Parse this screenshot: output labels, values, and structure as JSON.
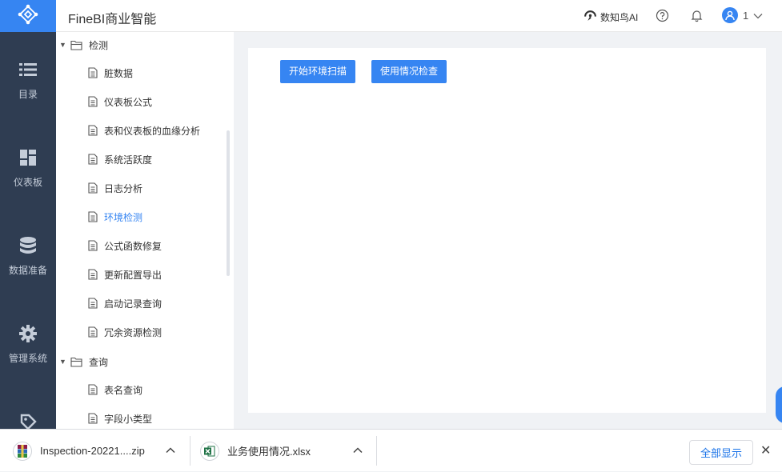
{
  "header": {
    "logo_icon": "network-nodes-icon",
    "title": "FineBI商业智能",
    "ai_label": "数知鸟AI",
    "user_name": "1"
  },
  "leftnav": {
    "items": [
      {
        "label": "目录",
        "icon": "list-icon"
      },
      {
        "label": "仪表板",
        "icon": "dashboard-icon"
      },
      {
        "label": "数据准备",
        "icon": "database-icon"
      },
      {
        "label": "管理系统",
        "icon": "gear-icon"
      },
      {
        "label": "",
        "icon": "tag-icon"
      }
    ]
  },
  "tree": {
    "folders": [
      {
        "label": "检测",
        "children": [
          "脏数据",
          "仪表板公式",
          "表和仪表板的血缘分析",
          "系统活跃度",
          "日志分析",
          "环境检测",
          "公式函数修复",
          "更新配置导出",
          "启动记录查询",
          "冗余资源检测"
        ]
      },
      {
        "label": "查询",
        "children": [
          "表名查询",
          "字段小类型"
        ]
      }
    ],
    "active": "环境检测"
  },
  "main": {
    "scan_button": "开始环境扫描",
    "usage_button": "使用情况检查"
  },
  "downloads": {
    "items": [
      {
        "name": "Inspection-20221....zip",
        "icon": "winrar-archive-icon"
      },
      {
        "name": "业务使用情况.xlsx",
        "icon": "excel-file-icon"
      }
    ],
    "show_all": "全部显示",
    "close": "✕"
  },
  "colors": {
    "accent": "#3685f2",
    "nav_bg": "#2f3d52",
    "page_bg": "#f0f2f5"
  }
}
